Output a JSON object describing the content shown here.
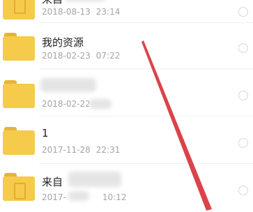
{
  "items": [
    {
      "title": "来自",
      "date": "2018-08-13",
      "time": "23:14"
    },
    {
      "title": "我的资源",
      "date": "2018-02-23",
      "time": "07:22"
    },
    {
      "title": "",
      "date": "2018-02-22",
      "time": ""
    },
    {
      "title": "1",
      "date": "2017-11-28",
      "time": "22:31"
    },
    {
      "title": "来自",
      "date": "2017-",
      "time": "10:12"
    }
  ],
  "colors": {
    "folder": "#f6ca4a",
    "folder_tab": "#e6b43a",
    "annotation_arrow": "#d9393f"
  },
  "icons": [
    "folder-icon",
    "folder-icon",
    "folder-icon",
    "folder-icon",
    "folder-icon"
  ]
}
